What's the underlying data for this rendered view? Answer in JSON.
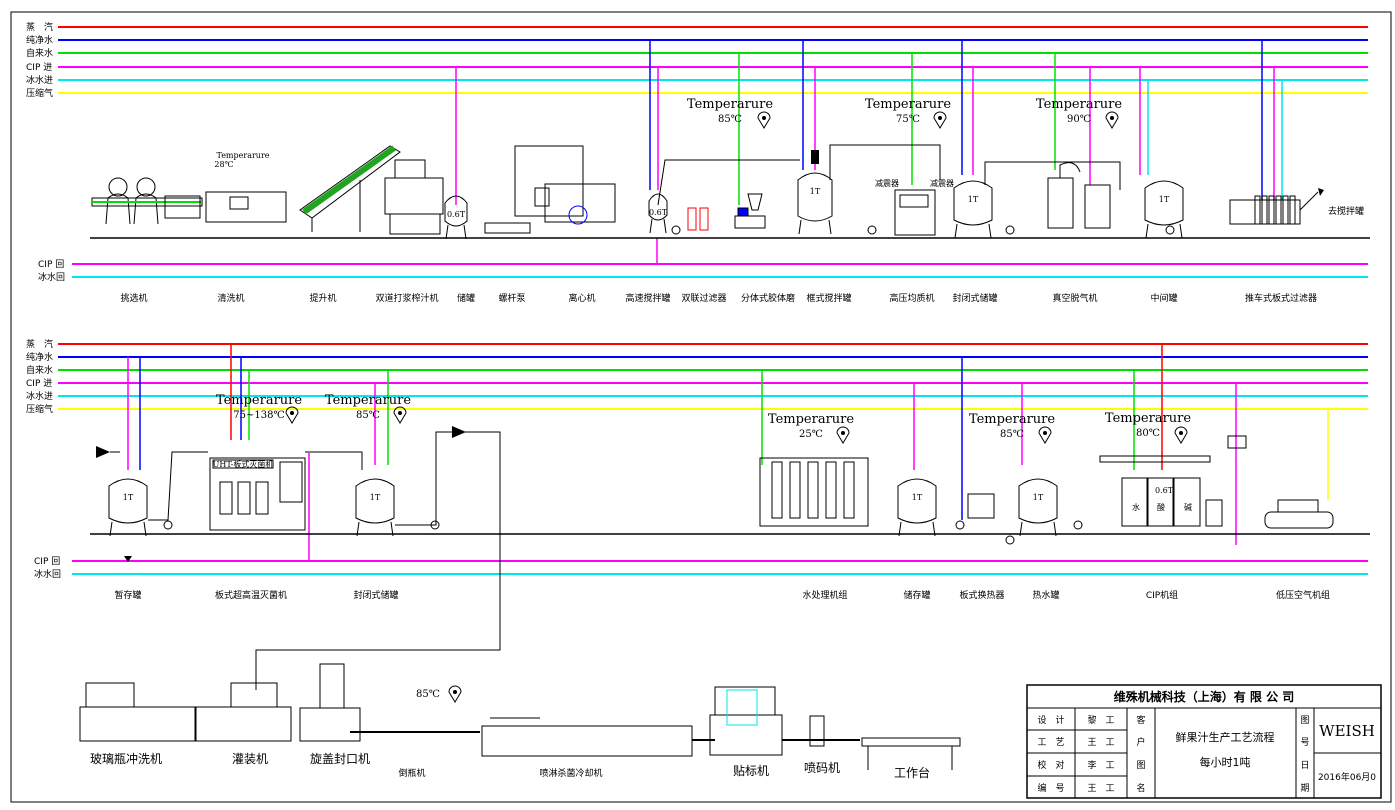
{
  "colors": {
    "steam": "#ff0000",
    "pure_water": "#0000ff",
    "tap_water": "#00e000",
    "cip": "#ff00ff",
    "ice_water": "#00e5ee",
    "air": "#ffff00"
  },
  "pipes_top": [
    {
      "label": "蒸　汽",
      "color": "steam"
    },
    {
      "label": "纯净水",
      "color": "pure_water"
    },
    {
      "label": "自来水",
      "color": "tap_water"
    },
    {
      "label": "CIP 进",
      "color": "cip"
    },
    {
      "label": "冰水进",
      "color": "ice_water"
    },
    {
      "label": "压缩气",
      "color": "air"
    }
  ],
  "pipes_return": [
    {
      "label": "CIP 回",
      "color": "cip"
    },
    {
      "label": "冰水回",
      "color": "ice_water"
    }
  ],
  "row1": {
    "machines": [
      "挑选机",
      "清洗机",
      "提升机",
      "双道打浆榨汁机",
      "储罐",
      "螺杆泵",
      "离心机",
      "高速搅拌罐",
      "双联过滤器",
      "分体式胶体磨",
      "框式搅拌罐",
      "高压均质机",
      "封闭式储罐",
      "真空脱气机",
      "中间罐",
      "推车式板式过滤器"
    ],
    "temps": [
      {
        "label": "Temperarure",
        "value": "28℃"
      },
      {
        "label": "Temperarure",
        "value": "85℃"
      },
      {
        "label": "Temperarure",
        "value": "75℃"
      },
      {
        "label": "Temperarure",
        "value": "90℃"
      }
    ],
    "tank_labels": [
      "0.6T",
      "0.6T",
      "1T",
      "1T",
      "1T"
    ],
    "to_mixing": "去搅拌罐",
    "small_labels": [
      "减震器",
      "减震器"
    ]
  },
  "row2": {
    "machines": [
      "暂存罐",
      "板式超高温灭菌机",
      "封闭式储罐",
      "水处理机组",
      "储存罐",
      "板式换热器",
      "热水罐",
      "CIP机组",
      "低压空气机组"
    ],
    "temps": [
      {
        "label": "Temperarure",
        "value": "75~138℃"
      },
      {
        "label": "Temperarure",
        "value": "85℃"
      },
      {
        "label": "Temperarure",
        "value": "25℃"
      },
      {
        "label": "Temperarure",
        "value": "85℃"
      },
      {
        "label": "Temperarure",
        "value": "80℃"
      }
    ],
    "tank_labels": [
      "1T",
      "1T",
      "1T",
      "1T"
    ],
    "cip_tanks": [
      "水",
      "酸",
      "碱"
    ],
    "cip_top": "0.6T",
    "uht_panel": "UHT-板式灭菌机"
  },
  "row3": {
    "machines": [
      "玻璃瓶冲洗机",
      "灌装机",
      "旋盖封口机",
      "倒瓶机",
      "喷淋杀菌冷却机",
      "贴标机",
      "喷码机",
      "工作台"
    ],
    "temp": "85℃"
  },
  "title_block": {
    "company": "维殊机械科技（上海）有 限 公 司",
    "rows": [
      {
        "role": "设　计",
        "name": "黎　工"
      },
      {
        "role": "工　艺",
        "name": "王　工"
      },
      {
        "role": "校　对",
        "name": "李　工"
      },
      {
        "role": "编　号",
        "name": "王　工"
      }
    ],
    "client": [
      "客",
      "户",
      "图",
      "名"
    ],
    "title": "鲜果汁生产工艺流程",
    "subtitle": "每小时1吨",
    "doc": [
      "图",
      "号",
      "日",
      "期"
    ],
    "brand": "WEISH",
    "date": "2016年06月0"
  }
}
